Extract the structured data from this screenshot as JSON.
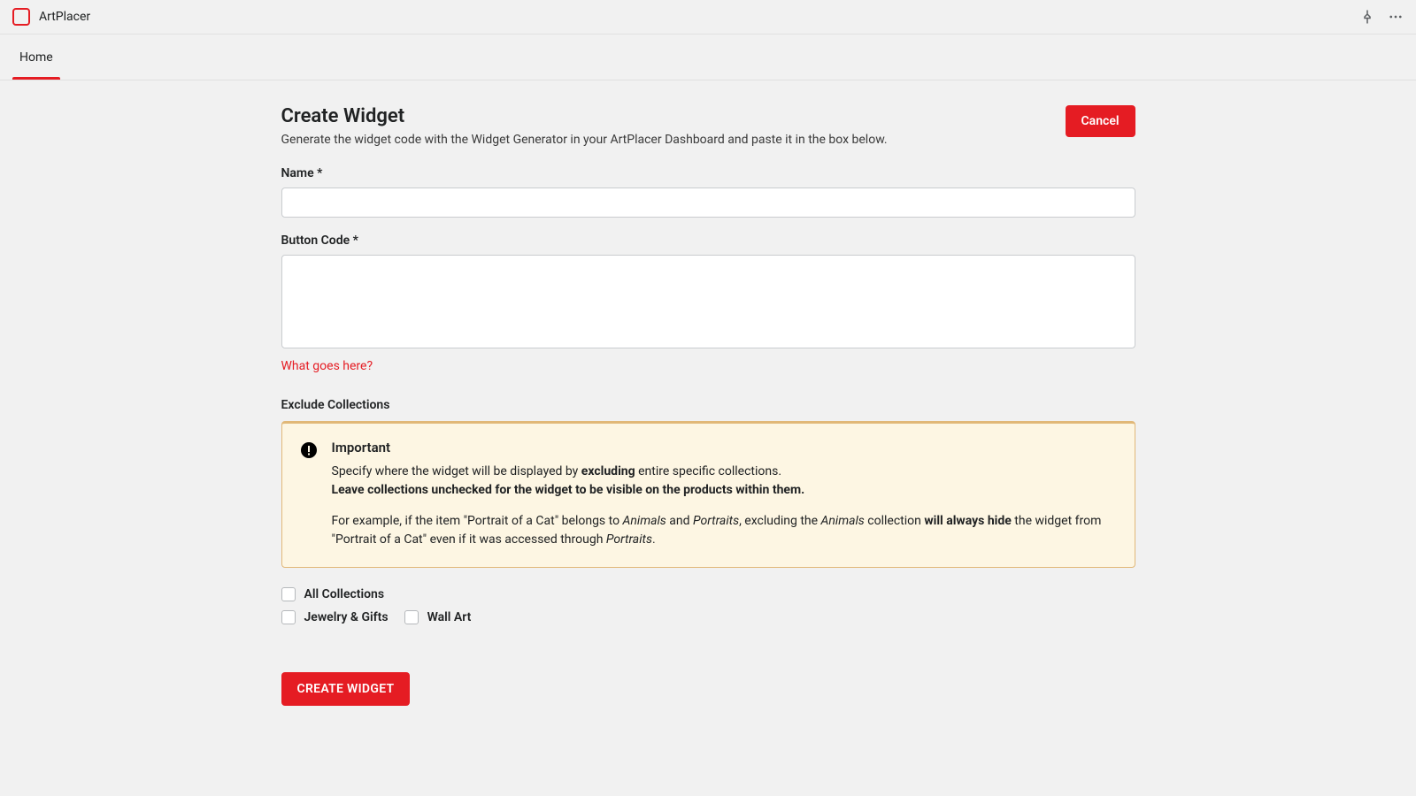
{
  "app": {
    "title": "ArtPlacer"
  },
  "tabs": {
    "home": "Home"
  },
  "header": {
    "title": "Create Widget",
    "subtitle": "Generate the widget code with the Widget Generator in your ArtPlacer Dashboard and paste it in the box below.",
    "cancel": "Cancel"
  },
  "form": {
    "name_label": "Name *",
    "button_code_label": "Button Code *",
    "help_link": "What goes here?",
    "exclude_label": "Exclude Collections",
    "alert": {
      "title": "Important",
      "line1_pre": "Specify where the widget will be displayed by ",
      "line1_bold": "excluding",
      "line1_post": " entire specific collections.",
      "line2": "Leave collections unchecked for the widget to be visible on the products within them.",
      "line3_a": "For example, if the item \"Portrait of a Cat\" belongs to ",
      "line3_b": "Animals",
      "line3_c": " and ",
      "line3_d": "Portraits",
      "line3_e": ", excluding the ",
      "line3_f": "Animals",
      "line3_g": " collection ",
      "line3_h": "will always hide",
      "line3_i": " the widget from \"Portrait of a Cat\" even if it was accessed through ",
      "line3_j": "Portraits",
      "line3_k": "."
    },
    "checkboxes": {
      "all": "All Collections",
      "c1": "Jewelry & Gifts",
      "c2": "Wall Art"
    },
    "submit": "CREATE WIDGET"
  }
}
